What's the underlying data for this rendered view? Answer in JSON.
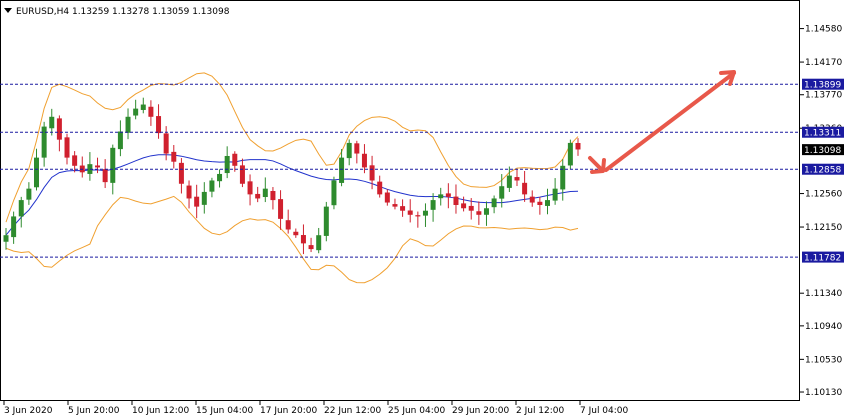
{
  "header": {
    "symbol_line": "EURUSD,H4  1.13259 1.13278 1.13059 1.13098"
  },
  "colors": {
    "background": "#ffffff",
    "bull_candle": "#2e8b2e",
    "bear_candle": "#d0202e",
    "bollinger": "#f0a030",
    "moving_average": "#2233cc",
    "level_line": "#1a1aa0",
    "arrow": "#e8584a",
    "price_box": "#000000"
  },
  "chart_data": {
    "type": "candlestick",
    "symbol": "EURUSD",
    "timeframe": "H4",
    "ohlc_header": {
      "open": 1.13259,
      "high": 1.13278,
      "low": 1.13059,
      "close": 1.13098
    },
    "ylim": [
      1.1002,
      1.1493
    ],
    "y_ticks": [
      "1.14580",
      "1.14170",
      "1.13770",
      "1.13360",
      "1.12560",
      "1.12150",
      "1.11340",
      "1.10940",
      "1.10530",
      "1.10130"
    ],
    "x_ticks": [
      "3 Jun 2020",
      "5 Jun 20:00",
      "10 Jun 12:00",
      "15 Jun 04:00",
      "17 Jun 20:00",
      "22 Jun 12:00",
      "25 Jun 04:00",
      "29 Jun 20:00",
      "2 Jul 12:00",
      "7 Jul 04:00"
    ],
    "levels": [
      {
        "label": "1.13899",
        "value": 1.13899
      },
      {
        "label": "1.13311",
        "value": 1.13311
      },
      {
        "label": "1.12858",
        "value": 1.12858
      },
      {
        "label": "1.11782",
        "value": 1.11782
      }
    ],
    "current_price": {
      "label": "1.13098",
      "value": 1.13098
    },
    "indicators": [
      "Bollinger Bands",
      "Moving Average"
    ],
    "close_path": [
      1.1205,
      1.1228,
      1.1248,
      1.1262,
      1.13,
      1.1338,
      1.135,
      1.1322,
      1.13,
      1.129,
      1.1282,
      1.1292,
      1.1288,
      1.127,
      1.1312,
      1.1332,
      1.135,
      1.136,
      1.1365,
      1.135,
      1.133,
      1.1305,
      1.1295,
      1.1268,
      1.125,
      1.124,
      1.1258,
      1.1272,
      1.128,
      1.1302,
      1.129,
      1.1268,
      1.1255,
      1.125,
      1.1262,
      1.1248,
      1.1225,
      1.1212,
      1.1205,
      1.1195,
      1.1188,
      1.1205,
      1.124,
      1.1272,
      1.13,
      1.1318,
      1.1305,
      1.1288,
      1.1272,
      1.1255,
      1.1245,
      1.124,
      1.1235,
      1.123,
      1.1228,
      1.1235,
      1.1248,
      1.1255,
      1.1252,
      1.1242,
      1.1238,
      1.1235,
      1.123,
      1.1238,
      1.125,
      1.1265,
      1.1278,
      1.1272,
      1.1255,
      1.1245,
      1.1242,
      1.1248,
      1.1262,
      1.129,
      1.1318,
      1.131
    ]
  }
}
